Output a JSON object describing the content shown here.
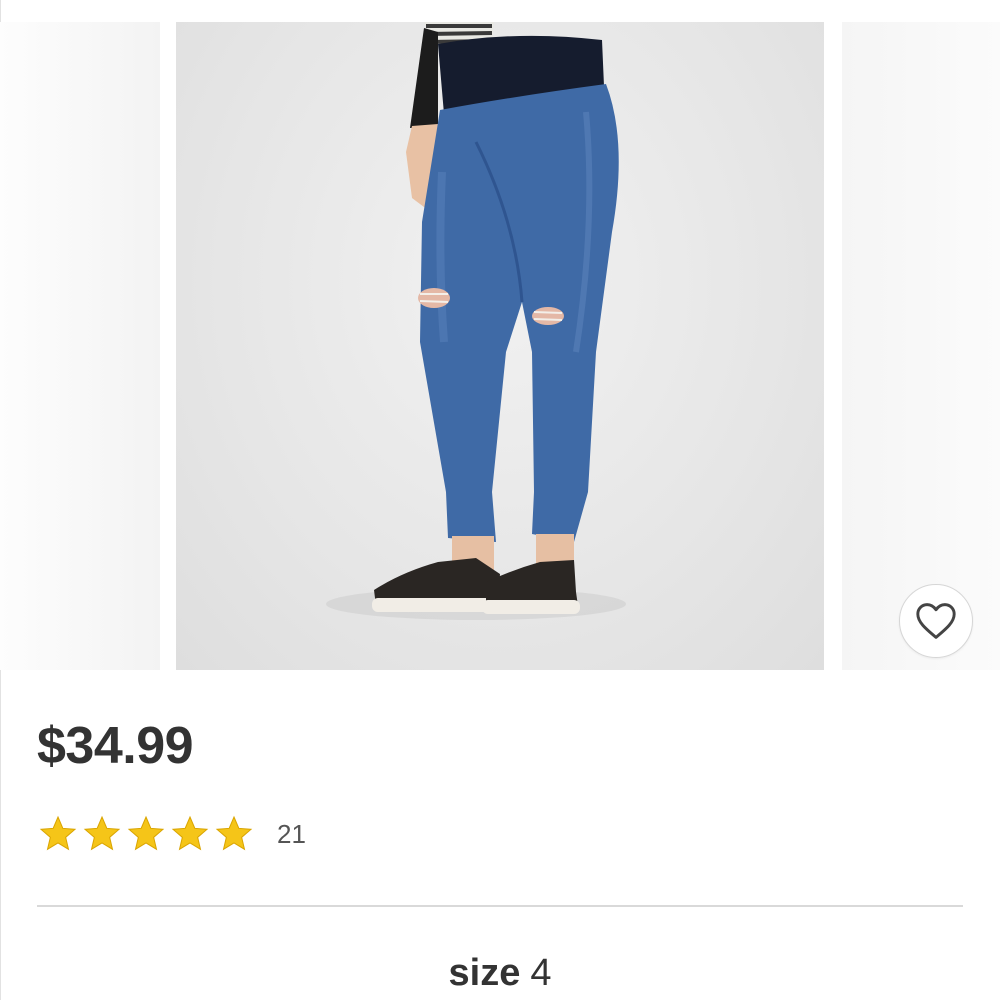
{
  "product": {
    "price": "$34.99",
    "rating": {
      "stars": 5,
      "max": 5,
      "count": "21"
    },
    "size": {
      "label": "size",
      "value": "4"
    }
  },
  "icons": {
    "favorite": "heart-outline-icon",
    "star": "star-icon"
  },
  "colors": {
    "star": "#F5C518",
    "price": "#333333",
    "divider": "#d9d9d9"
  }
}
